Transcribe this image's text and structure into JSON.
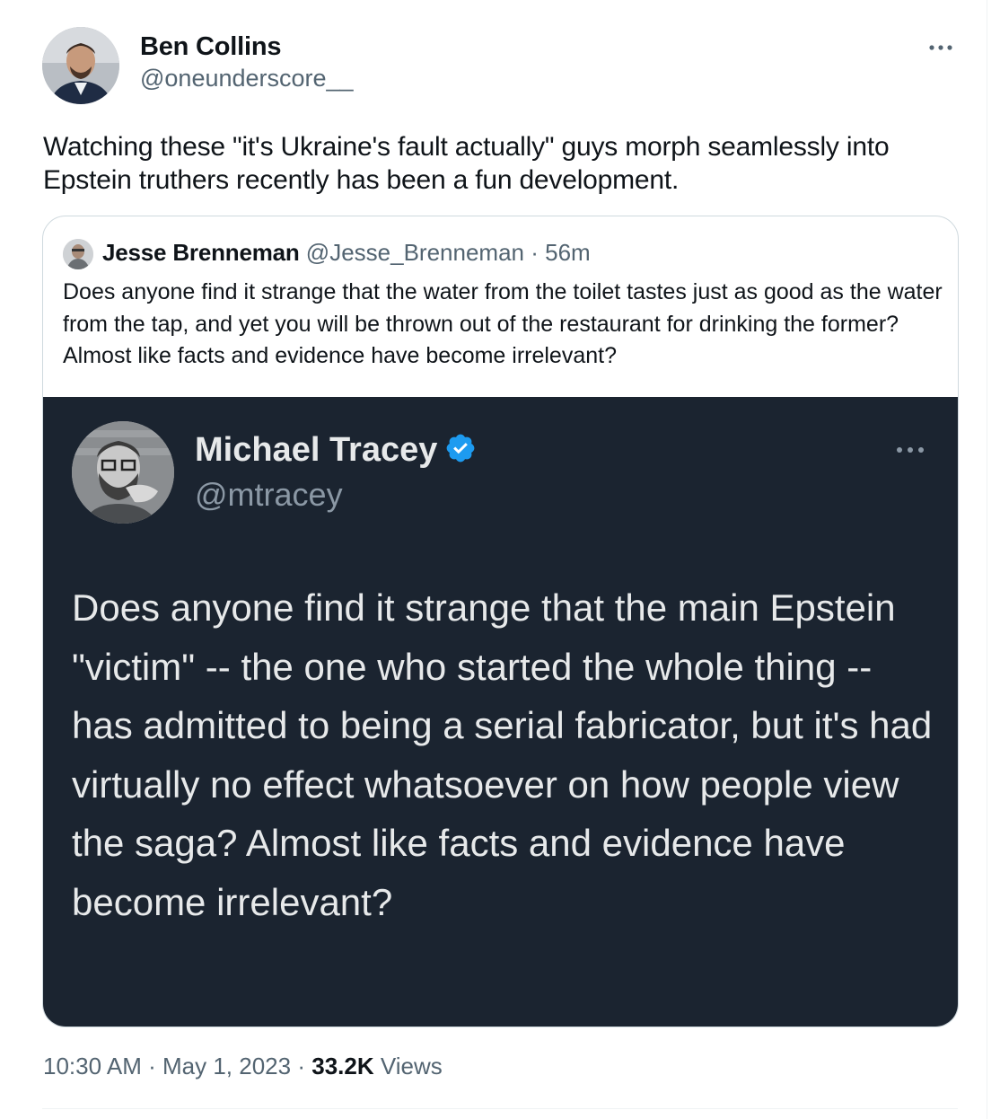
{
  "tweet": {
    "author": {
      "name": "Ben Collins",
      "handle": "@oneunderscore__"
    },
    "text": "Watching these \"it's Ukraine's fault actually\" guys morph seamlessly into Epstein truthers recently has been a fun development.",
    "more_icon": "more-horizontal-icon",
    "quote": {
      "author_name": "Jesse Brenneman",
      "author_handle": "@Jesse_Brenneman",
      "separator": "·",
      "time": "56m",
      "text": "Does anyone find it strange that the water from the toilet tastes just as good as the water from the tap, and yet you will be thrown out of the restaurant for drinking the former? Almost like facts and evidence have become irrelevant?",
      "embedded_screenshot": {
        "name": "Michael Tracey",
        "handle": "@mtracey",
        "verified_icon": "verified-badge-icon",
        "text": "Does anyone find it strange that the main Epstein \"victim\" -- the one who started the whole thing -- has admitted to being a serial fabricator, but it's had virtually no effect whatsoever on how people view the saga? Almost like facts and evidence have become irrelevant?",
        "background_color": "#1b2430",
        "badge_color": "#1d9bf0"
      }
    },
    "meta": {
      "time": "10:30 AM",
      "dot": "·",
      "date": "May 1, 2023",
      "views_count": "33.2K",
      "views_label": "Views"
    }
  }
}
